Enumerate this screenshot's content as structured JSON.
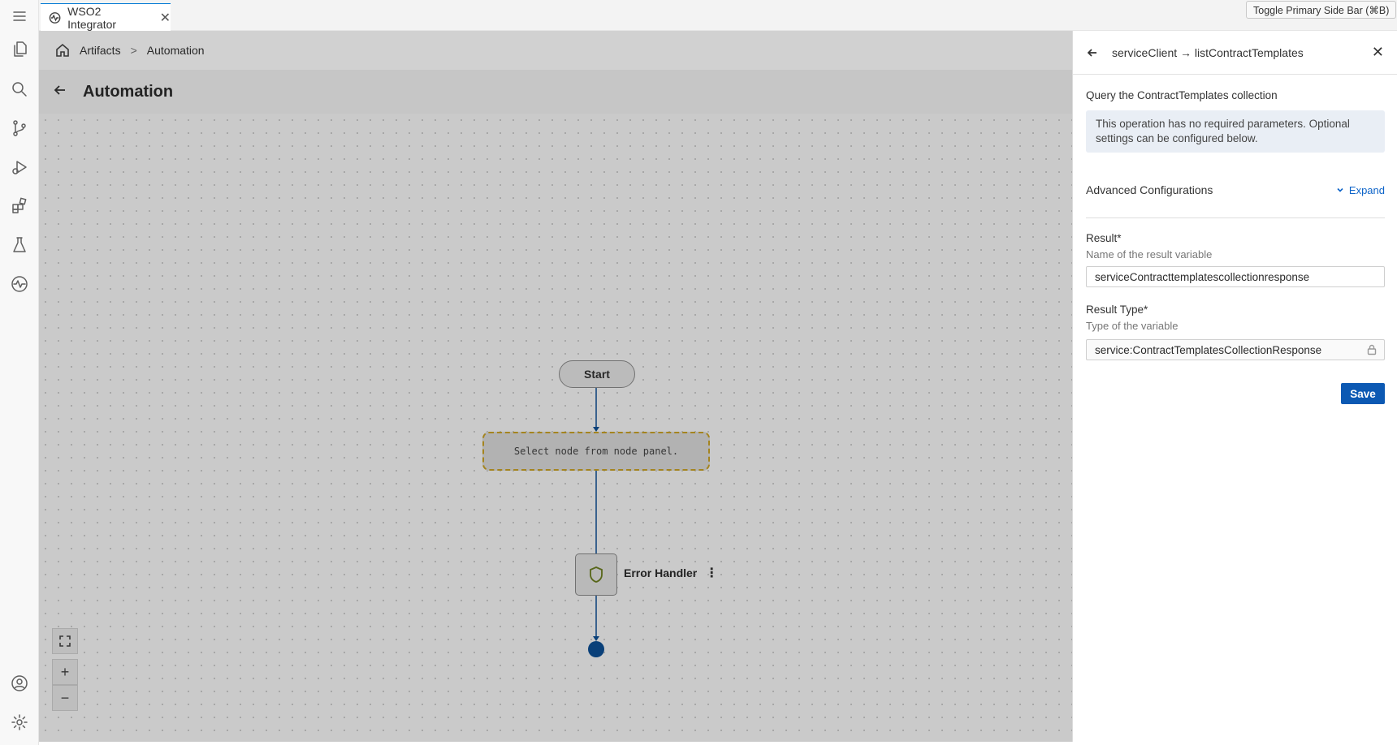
{
  "tab": {
    "label": "WSO2 Integrator",
    "close": "✕"
  },
  "tooltip": "Toggle Primary Side Bar (⌘B)",
  "breadcrumb": {
    "items": [
      "Artifacts",
      "Automation"
    ],
    "separator": ">"
  },
  "page": {
    "title": "Automation"
  },
  "flow": {
    "start_label": "Start",
    "placeholder_text": "Select node from node panel.",
    "error_handler_label": "Error Handler",
    "kebab": "⋮"
  },
  "zoom": {
    "zoom_in": "+",
    "zoom_out": "−"
  },
  "panel": {
    "title": "serviceClient → listContractTemplates",
    "close": "✕",
    "description": "Query the ContractTemplates collection",
    "info": "This operation has no required parameters. Optional settings can be configured below.",
    "advanced_label": "Advanced Configurations",
    "expand_label": "Expand",
    "result_label": "Result*",
    "result_hint": "Name of the result variable",
    "result_value": "serviceContracttemplatescollectionresponse",
    "result_type_label": "Result Type*",
    "result_type_hint": "Type of the variable",
    "result_type_value": "service:ContractTemplatesCollectionResponse",
    "save_label": "Save"
  },
  "colors": {
    "accent": "#0c59b3",
    "link": "#0c63c8",
    "end_node": "#0d4f94",
    "placeholder_border": "#c9a227"
  },
  "icons": {
    "activity": [
      "menu-icon",
      "explorer-icon",
      "search-icon",
      "source-control-icon",
      "run-debug-icon",
      "extensions-icon",
      "testing-icon",
      "integrator-icon",
      "account-icon",
      "settings-icon"
    ]
  }
}
